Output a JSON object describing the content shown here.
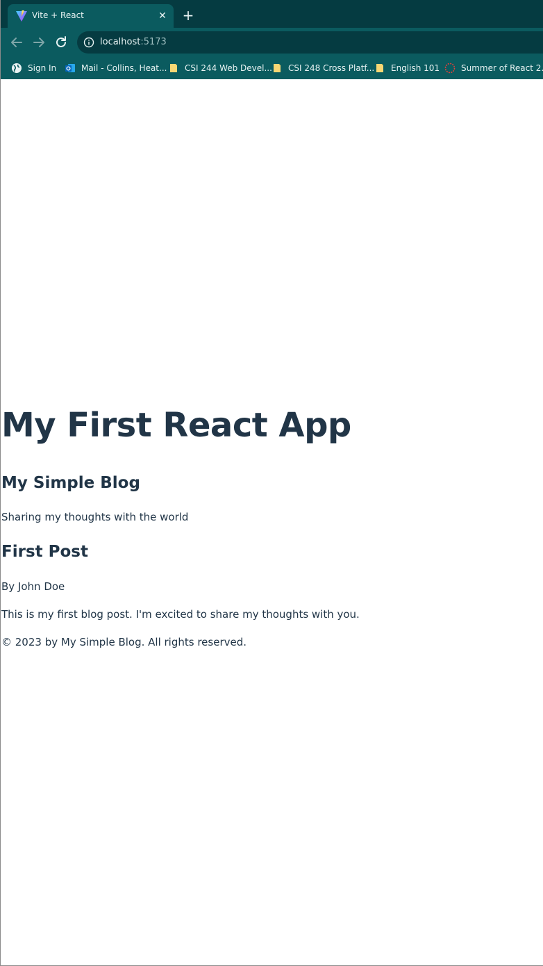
{
  "browser": {
    "tab": {
      "title": "Vite + React",
      "favicon": "vite-logo-icon"
    },
    "address_bar": {
      "host": "localhost",
      "port": ":5173",
      "icon": "info-icon"
    },
    "bookmarks": [
      {
        "label": "Sign In",
        "icon": "globe-icon"
      },
      {
        "label": "Mail - Collins, Heat...",
        "icon": "outlook-icon"
      },
      {
        "label": "CSI 244 Web Devel...",
        "icon": "note-icon"
      },
      {
        "label": "CSI 248 Cross Platf...",
        "icon": "note-icon"
      },
      {
        "label": "English 101",
        "icon": "note-icon"
      },
      {
        "label": "Summer of React 2...",
        "icon": "react-icon"
      }
    ],
    "colors": {
      "tabstrip": "#053b41",
      "toolbar": "#0b5b5f",
      "text": "#e8f3f3"
    }
  },
  "page": {
    "app_title": "My First React App",
    "blog": {
      "title": "My Simple Blog",
      "tagline": "Sharing my thoughts with the world"
    },
    "post": {
      "title": "First Post",
      "author": "By John Doe",
      "body": "This is my first blog post. I'm excited to share my thoughts with you."
    },
    "footer": {
      "text": "© 2023 by My Simple Blog. All rights reserved."
    },
    "colors": {
      "text": "#213547",
      "background": "#ffffff"
    }
  }
}
